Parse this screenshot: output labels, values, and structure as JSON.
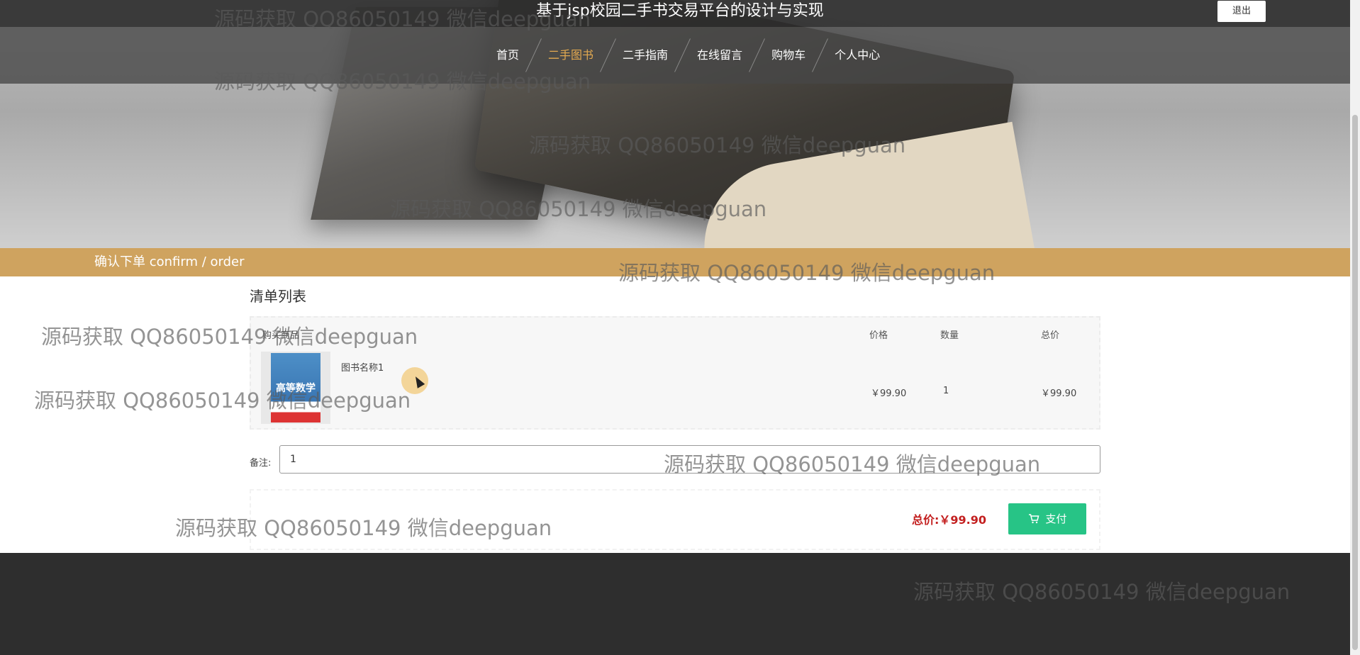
{
  "header": {
    "site_title": "基于jsp校园二手书交易平台的设计与实现",
    "logout_label": "退出"
  },
  "nav": {
    "items": [
      {
        "label": "首页"
      },
      {
        "label": "二手图书",
        "active": true
      },
      {
        "label": "二手指南"
      },
      {
        "label": "在线留言"
      },
      {
        "label": "购物车"
      },
      {
        "label": "个人中心"
      }
    ]
  },
  "breadcrumb": {
    "text": "确认下单  confirm / order"
  },
  "order": {
    "section_title": "清单列表",
    "headers": {
      "item": "购买商品",
      "price": "价格",
      "quantity": "数量",
      "total": "总价"
    },
    "items": [
      {
        "name": "图书名称1",
        "price": "￥99.90",
        "quantity": "1",
        "total": "￥99.90",
        "cover_text": "高等数学"
      }
    ],
    "remark_label": "备注:",
    "remark_value": "1",
    "grand_total_label": "总价:",
    "grand_total_value": "￥99.90",
    "pay_label": "支付"
  },
  "watermark_text": "源码获取 QQ86050149 微信deepguan",
  "colors": {
    "accent": "#e3a950",
    "strip": "#cfa35f",
    "pay_button": "#27c486",
    "total_text": "#c31f1f"
  },
  "icons": {
    "cart": "cart-icon"
  }
}
